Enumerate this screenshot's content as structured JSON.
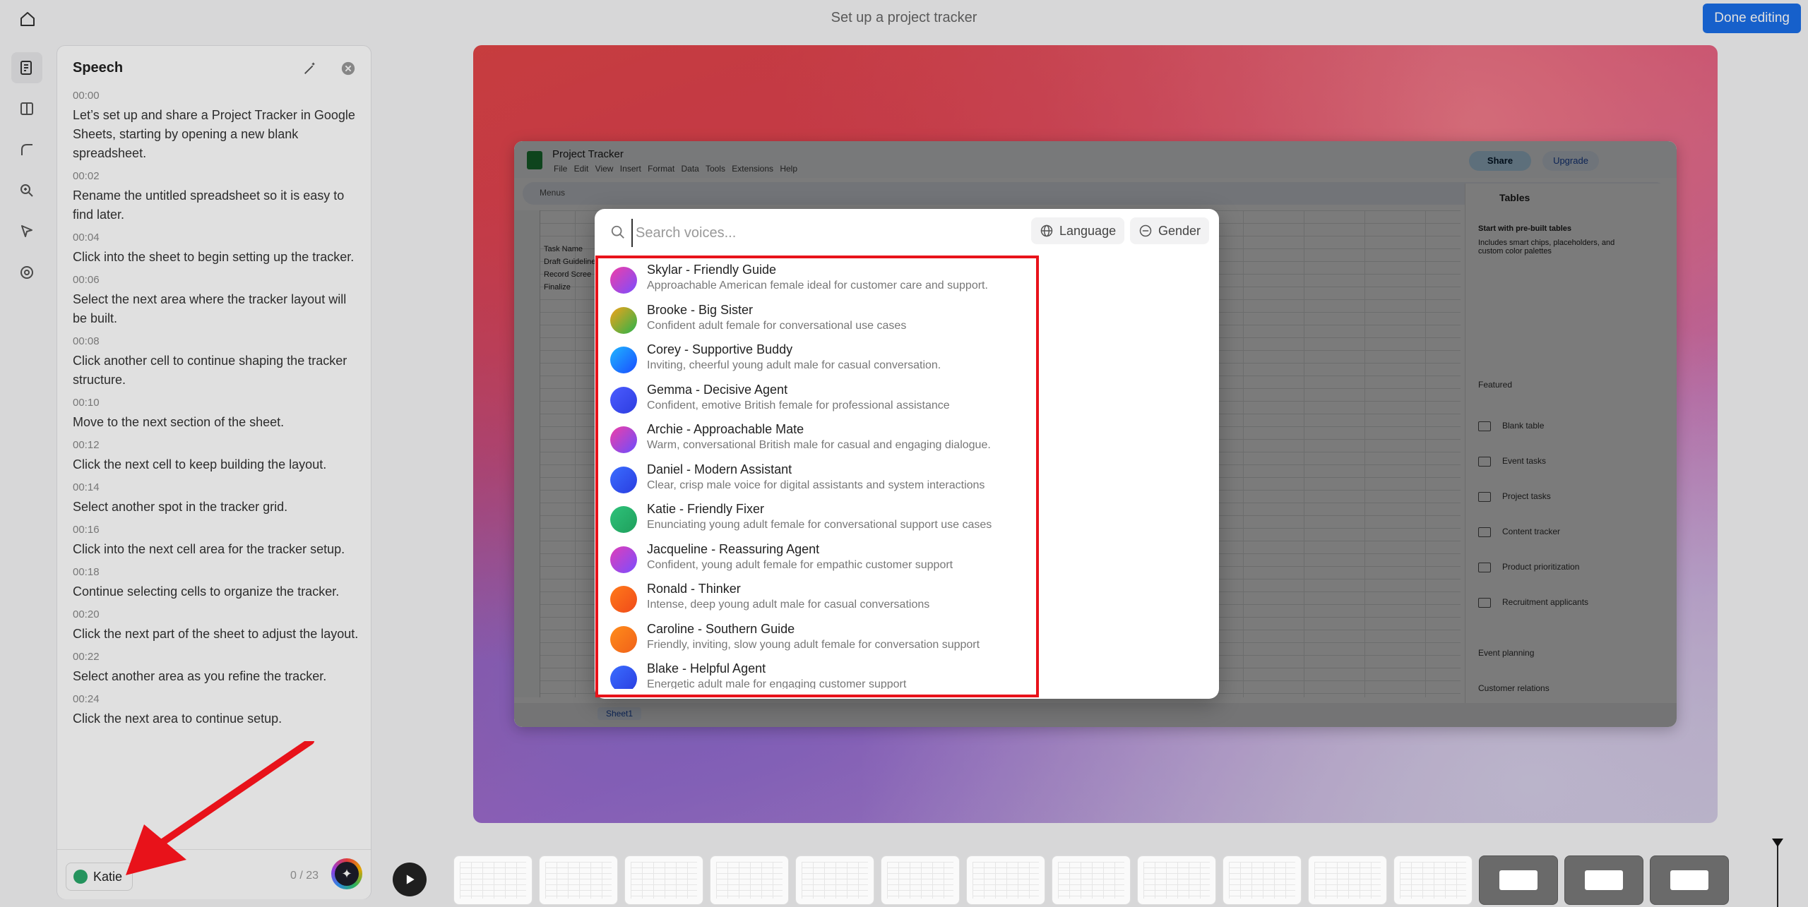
{
  "app": {
    "title": "Set up a project tracker",
    "done_label": "Done editing"
  },
  "rail": {
    "icons": [
      "script-icon",
      "layout-icon",
      "curve-icon",
      "zoom-icon",
      "cursor-icon",
      "help-icon"
    ]
  },
  "speech": {
    "title": "Speech",
    "segments": [
      {
        "time": "00:00",
        "text": "Let’s set up and share a Project Tracker in Google Sheets, starting by opening a new blank spreadsheet."
      },
      {
        "time": "00:02",
        "text": "Rename the untitled spreadsheet so it is easy to find later."
      },
      {
        "time": "00:04",
        "text": "Click into the sheet to begin setting up the tracker."
      },
      {
        "time": "00:06",
        "text": "Select the next area where the tracker layout will be built."
      },
      {
        "time": "00:08",
        "text": "Click another cell to continue shaping the tracker structure."
      },
      {
        "time": "00:10",
        "text": "Move to the next section of the sheet."
      },
      {
        "time": "00:12",
        "text": "Click the next cell to keep building the layout."
      },
      {
        "time": "00:14",
        "text": "Select another spot in the tracker grid."
      },
      {
        "time": "00:16",
        "text": "Click into the next cell area for the tracker setup."
      },
      {
        "time": "00:18",
        "text": "Continue selecting cells to organize the tracker."
      },
      {
        "time": "00:20",
        "text": "Click the next part of the sheet to adjust the layout."
      },
      {
        "time": "00:22",
        "text": "Select another area as you refine the tracker."
      },
      {
        "time": "00:24",
        "text": "Click the next area to continue setup."
      }
    ],
    "voice_chip": "Katie",
    "char_count": "0 / 23"
  },
  "sheets": {
    "file_name": "Project Tracker",
    "menus": "File Edit View Insert Format Data Tools Extensions Help",
    "share": "Share",
    "upgrade": "Upgrade",
    "toolbar": "Menus",
    "cells": [
      "Task Name",
      "Draft Guideline",
      "Record Scree",
      "Finalize"
    ],
    "side_title": "Tables",
    "side_sub": "Start with pre-built tables",
    "side_sub2": "Includes smart chips, placeholders, and custom color palettes",
    "featured": "Featured",
    "side_items": [
      "Blank table",
      "Event tasks",
      "Project tasks",
      "Content tracker",
      "Product prioritization",
      "Recruitment applicants"
    ],
    "side_groups": [
      "Event planning",
      "Customer relations"
    ],
    "tab": "Sheet1"
  },
  "picker": {
    "search_placeholder": "Search voices...",
    "language_label": "Language",
    "gender_label": "Gender",
    "voices": [
      {
        "name": "Skylar - Friendly Guide",
        "desc": "Approachable American female ideal for customer care and support.",
        "color_a": "#f03ea6",
        "color_b": "#7a4dff"
      },
      {
        "name": "Brooke - Big Sister",
        "desc": "Confident adult female for conversational use cases",
        "color_a": "#f2a21a",
        "color_b": "#29b34b"
      },
      {
        "name": "Corey - Supportive Buddy",
        "desc": "Inviting, cheerful young adult male for casual conversation.",
        "color_a": "#1fb6ff",
        "color_b": "#1a4cff"
      },
      {
        "name": "Gemma - Decisive Agent",
        "desc": "Confident, emotive British female for professional assistance",
        "color_a": "#4b5cff",
        "color_b": "#2d3de0"
      },
      {
        "name": "Archie - Approachable Mate",
        "desc": "Warm, conversational British male for casual and engaging dialogue.",
        "color_a": "#f03ea6",
        "color_b": "#6b4dff"
      },
      {
        "name": "Daniel - Modern Assistant",
        "desc": "Clear, crisp male voice for digital assistants and system interactions",
        "color_a": "#3a6dff",
        "color_b": "#2a3de0"
      },
      {
        "name": "Katie - Friendly Fixer",
        "desc": "Enunciating young adult female for conversational support use cases",
        "color_a": "#2ec27a",
        "color_b": "#1f9f5c"
      },
      {
        "name": "Jacqueline - Reassuring Agent",
        "desc": "Confident, young adult female for empathic customer support",
        "color_a": "#e03eb8",
        "color_b": "#7a4dff"
      },
      {
        "name": "Ronald - Thinker",
        "desc": "Intense, deep young adult male for casual conversations",
        "color_a": "#ff7a1a",
        "color_b": "#f04a1a"
      },
      {
        "name": "Caroline - Southern Guide",
        "desc": "Friendly, inviting, slow young adult female for conversation support",
        "color_a": "#ff8c1a",
        "color_b": "#f0611a"
      },
      {
        "name": "Blake - Helpful Agent",
        "desc": "Energetic adult male for engaging customer support",
        "color_a": "#3a6dff",
        "color_b": "#2a3de0"
      }
    ]
  },
  "timeline": {
    "thumb_count": 15
  },
  "colors": {
    "accent": "#1a6ee8",
    "highlight": "#e8121a",
    "arrow": "#e8121a"
  }
}
